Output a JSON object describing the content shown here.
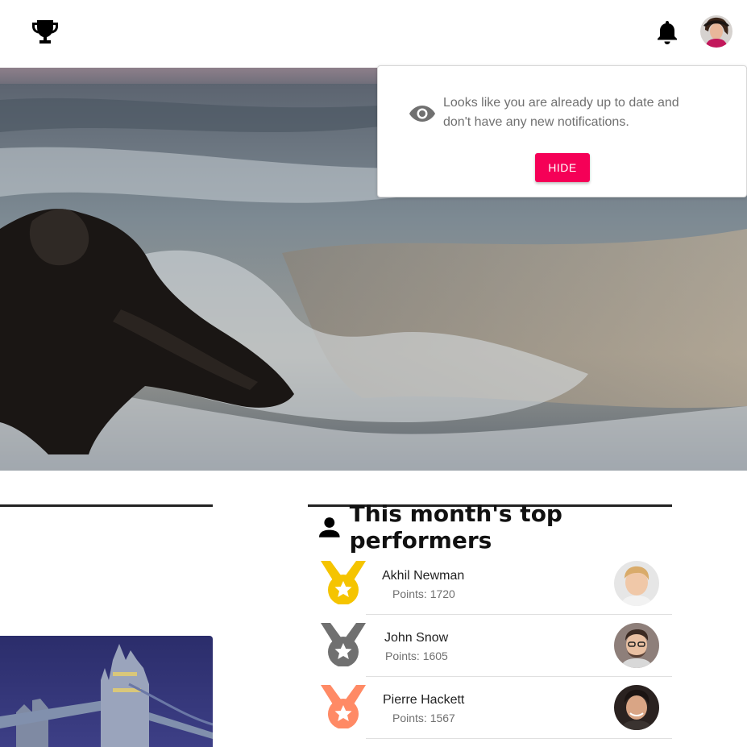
{
  "header": {
    "logo_icon": "trophy-icon",
    "notification_icon": "bell-icon",
    "avatar_icon": "user-avatar"
  },
  "notification_popup": {
    "icon": "eye-icon",
    "message": "Looks like you are already up to date and don't have any new notifications.",
    "hide_label": "HIDE",
    "accent_color": "#f50057"
  },
  "top_performers": {
    "icon": "person-icon",
    "title": "This month's top performers",
    "entries": [
      {
        "name": "Akhil Newman",
        "points": "Points: 1720",
        "medal": "gold-medal-icon",
        "medal_color": "#f5c400"
      },
      {
        "name": "John Snow",
        "points": "Points: 1605",
        "medal": "silver-medal-icon",
        "medal_color": "#707070"
      },
      {
        "name": "Pierre Hackett",
        "points": "Points: 1567",
        "medal": "bronze-medal-icon",
        "medal_color": "#ff8a65"
      }
    ]
  }
}
